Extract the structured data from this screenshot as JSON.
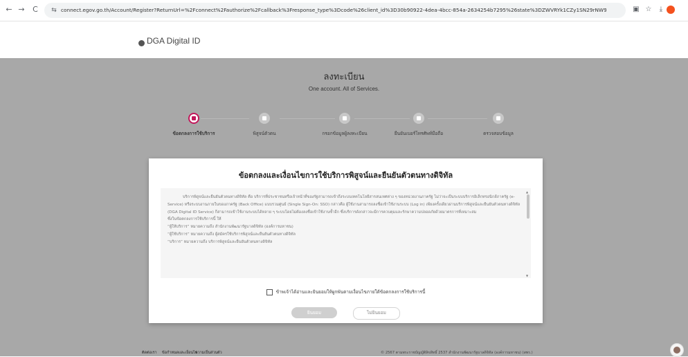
{
  "browser": {
    "url": "connect.egov.go.th/Account/Register?ReturnUrl=%2Fconnect%2Fauthorize%2Fcallback%3Fresponse_type%3Dcode%26client_id%3D30b90922-4dea-4bcc-854a-2634254b7295%26state%3DZWVRYk1CZy1SN29rNW9MUmF4TGxwWGZ6bmJpOWsxY3hkb...",
    "back_glyph": "←",
    "forward_glyph": "→",
    "reload_glyph": "C",
    "site_info_glyph": "⇆",
    "translate_glyph": "▣",
    "star_glyph": "☆",
    "download_glyph": "⤓"
  },
  "header": {
    "logo_text": "DGA Digital ID"
  },
  "page": {
    "title": "ลงทะเบียน",
    "subtitle": "One account. All of Services."
  },
  "steps": [
    {
      "label": "ข้อตกลงการใช้บริการ",
      "active": true,
      "icon": "document-icon"
    },
    {
      "label": "พิสูจน์ตัวตน",
      "active": false,
      "icon": "identity-icon"
    },
    {
      "label": "กรอกข้อมูลผู้ลงทะเบียน",
      "active": false,
      "icon": "user-icon"
    },
    {
      "label": "ยืนยันเบอร์โทรศัพท์มือถือ",
      "active": false,
      "icon": "phone-icon"
    },
    {
      "label": "ตรวจสอบข้อมูล",
      "active": false,
      "icon": "review-icon"
    }
  ],
  "modal": {
    "title": "ข้อตกลงและเงื่อนไขการใช้บริการพิสูจน์และยืนยันตัวตนทางดิจิทัล",
    "terms": [
      "บริการพิสูจน์และยืนยันตัวตนทางดิจิทัล คือ บริการที่ประชาชนหรือเจ้าหน้าที่ของรัฐสามารถเข้าถึงระบบเทคโนโลยีสารสนเทศต่าง ๆ ของหน่วยงานภาครัฐ ไม่ว่าจะเป็นระบบบริการอิเล็กทรอนิกส์ภาครัฐ (e-Service) หรือระบบงานภายในของภาครัฐ (Back Office) แบบรวมศูนย์ (Single Sign-On: SSO) กล่าวคือ ผู้ใช้งานสามารถลงชื่อเข้าใช้งานระบบ (Log in) เพียงครั้งเดียวผ่านบริการพิสูจน์และยืนยันตัวตนทางดิจิทัล (DGA Digital ID Service) ก็สามารถเข้าใช้งานระบบได้หลาย ๆ ระบบโดยไม่ต้องลงชื่อเข้าใช้งานซ้ำอีก ซึ่งบริการดังกล่าวจะมีการควบคุมและรักษาความปลอดภัยด้วยมาตรการที่เหมาะสม",
      "ซึ่งในข้อตกลงการใช้บริการนี้ ให้",
      "“ผู้ให้บริการ” หมายความถึง สำนักงานพัฒนารัฐบาลดิจิทัล (องค์การมหาชน)",
      "“ผู้ใช้บริการ” หมายความถึง ผู้สมัครใช้บริการพิสูจน์และยืนยันตัวตนทางดิจิทัล",
      "“บริการ” หมายความถึง บริการพิสูจน์และยืนยันตัวตนทางดิจิทัล"
    ],
    "agree_label": "ข้าพเจ้าได้อ่านและยินยอมให้ผูกพันตามเงื่อนไขภายใต้ข้อตกลงการใช้บริการนี้",
    "accept_label": "ยินยอม",
    "decline_label": "ไม่ยินยอม"
  },
  "footer": {
    "links": [
      "ติดต่อเรา",
      "ข้อกำหนดและเงื่อนไข",
      "ความเป็นส่วนตัว"
    ],
    "copyright": "© 2567 ตามพระราชบัญญัติลิขสิทธิ์ 2537 สำนักงานพัฒนารัฐบาลดิจิทัล (องค์การมหาชน) (สพร.)"
  },
  "colors": {
    "accent": "#c2185b",
    "overlay": "#a8a8a8"
  }
}
